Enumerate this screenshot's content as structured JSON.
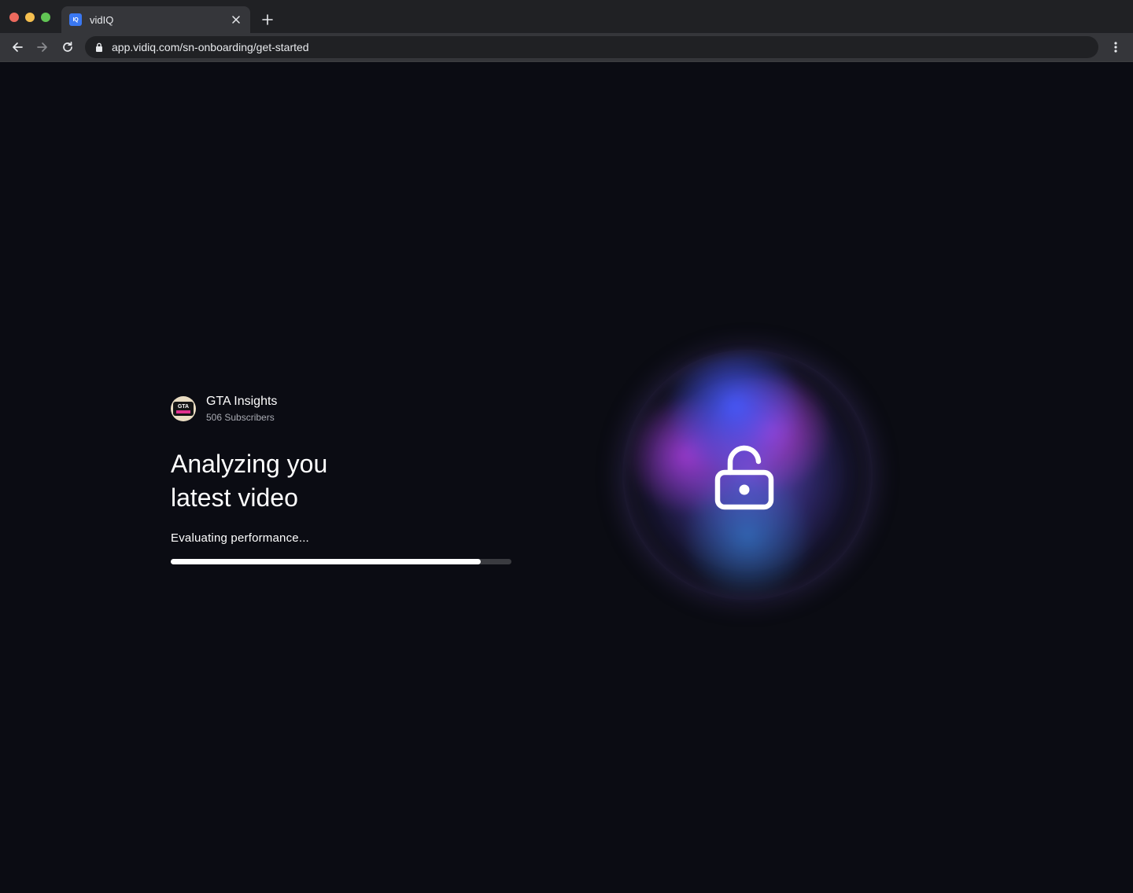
{
  "browser": {
    "tab_title": "vidIQ",
    "favicon_text": "IQ",
    "url": "app.vidiq.com/sn-onboarding/get-started"
  },
  "channel": {
    "name": "GTA Insights",
    "subscribers": "506 Subscribers"
  },
  "headline": {
    "line1": "Analyzing you",
    "line2": "latest video"
  },
  "status_text": "Evaluating performance...",
  "progress": 0.91,
  "colors": {
    "page_background": "#0b0c13",
    "orb_blue": "#465aff",
    "orb_purple": "#be3cd2",
    "progress_fill": "#ffffff",
    "progress_track": "#3a3b40"
  },
  "icons": {
    "orb_icon": "unlock-icon"
  }
}
